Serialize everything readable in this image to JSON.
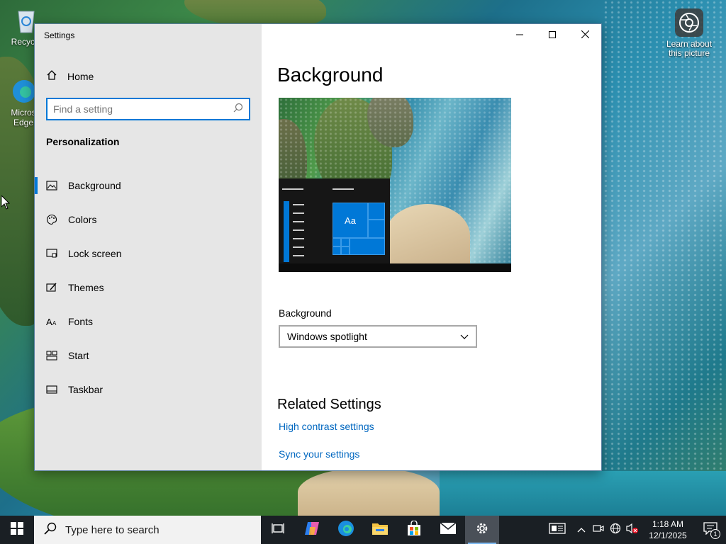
{
  "desktop": {
    "icons": [
      {
        "label": "Recycle"
      },
      {
        "label": "Micros Edge"
      }
    ],
    "spotlight": {
      "label": "Learn about this picture"
    }
  },
  "window": {
    "title": "Settings",
    "controls": {
      "minimize": "minimize-icon",
      "maximize": "maximize-icon",
      "close": "close-icon"
    },
    "sidebar": {
      "home_label": "Home",
      "search_placeholder": "Find a setting",
      "section_title": "Personalization",
      "items": [
        {
          "label": "Background",
          "icon": "picture-icon",
          "active": true
        },
        {
          "label": "Colors",
          "icon": "palette-icon",
          "active": false
        },
        {
          "label": "Lock screen",
          "icon": "lock-screen-icon",
          "active": false
        },
        {
          "label": "Themes",
          "icon": "themes-icon",
          "active": false
        },
        {
          "label": "Fonts",
          "icon": "fonts-icon",
          "active": false
        },
        {
          "label": "Start",
          "icon": "start-icon",
          "active": false
        },
        {
          "label": "Taskbar",
          "icon": "taskbar-icon",
          "active": false
        }
      ]
    },
    "content": {
      "heading": "Background",
      "preview_tile_label": "Aa",
      "background_label": "Background",
      "background_value": "Windows spotlight",
      "related_heading": "Related Settings",
      "links": [
        "High contrast settings",
        "Sync your settings"
      ]
    }
  },
  "taskbar": {
    "search_placeholder": "Type here to search",
    "apps": [
      {
        "icon": "task-view-icon",
        "active": false
      },
      {
        "icon": "copilot-icon",
        "active": false
      },
      {
        "icon": "edge-icon",
        "active": false
      },
      {
        "icon": "file-explorer-icon",
        "active": false
      },
      {
        "icon": "store-icon",
        "active": false
      },
      {
        "icon": "mail-icon",
        "active": false
      },
      {
        "icon": "settings-icon",
        "active": true
      }
    ],
    "clock": {
      "time": "1:18 AM",
      "date": "12/1/2025"
    },
    "notification_count": "1"
  },
  "colors": {
    "accent": "#0078d7",
    "link": "#0067c0",
    "sidebar_bg": "#e6e6e6",
    "taskbar_bg": "#1a1f24"
  }
}
